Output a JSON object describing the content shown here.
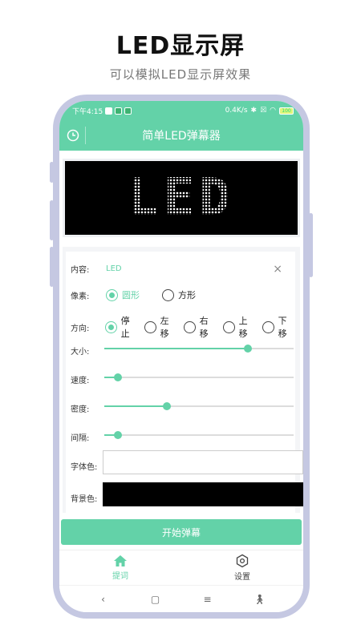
{
  "promo": {
    "title": "LED显示屏",
    "subtitle": "可以模拟LED显示屏效果"
  },
  "status_bar": {
    "time": "下午4:15",
    "net_speed": "0.4K/s",
    "battery": "100"
  },
  "app_bar": {
    "title": "简单LED弹幕器",
    "left_icon": "clock-icon"
  },
  "led_preview": {
    "text": "LED"
  },
  "form": {
    "content": {
      "label": "内容:",
      "value": "LED",
      "clear_icon": "×"
    },
    "pixel": {
      "label": "像素:",
      "options": [
        "圆形",
        "方形"
      ],
      "selected": "圆形"
    },
    "direction": {
      "label": "方向:",
      "options": [
        "停止",
        "左移",
        "右移",
        "上移",
        "下移"
      ],
      "selected": "停止"
    },
    "size": {
      "label": "大小:",
      "value": 0.76
    },
    "speed": {
      "label": "速度:",
      "value": 0.07
    },
    "density": {
      "label": "密度:",
      "value": 0.33
    },
    "spacing": {
      "label": "间隔:",
      "value": 0.07
    },
    "font_color": {
      "label": "字体色:",
      "color": "#ffffff"
    },
    "bg_color": {
      "label": "背景色:",
      "color": "#000000"
    }
  },
  "start_button": {
    "label": "开始弹幕"
  },
  "tabs": [
    {
      "label": "提词",
      "icon": "home-icon",
      "active": true
    },
    {
      "label": "设置",
      "icon": "settings-hex-icon",
      "active": false
    }
  ],
  "nav": [
    "back-icon",
    "home-square-icon",
    "menu-icon",
    "accessibility-icon"
  ],
  "colors": {
    "accent": "#63d2a8",
    "frame": "#c5c8e2"
  }
}
